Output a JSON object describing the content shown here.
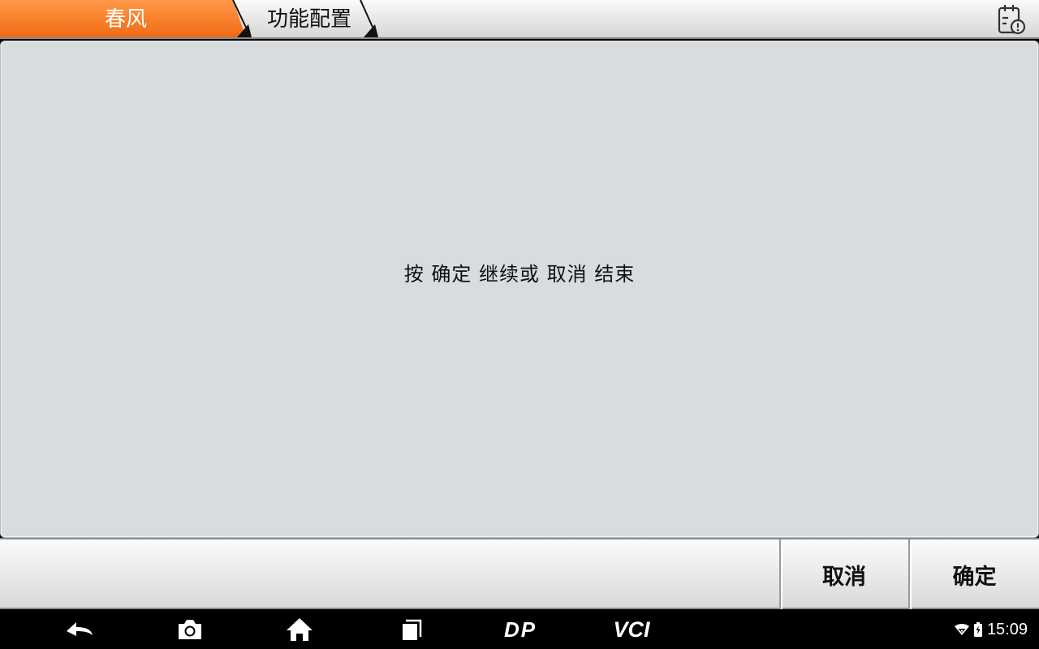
{
  "header": {
    "breadcrumbs": [
      {
        "label": "春风",
        "active": true
      },
      {
        "label": "功能配置",
        "active": false
      }
    ],
    "report_icon": "calendar-alert-icon",
    "colors": {
      "active": "#f47a20",
      "separator": "#111111"
    }
  },
  "content": {
    "message": "按 确定 继续或 取消 结束"
  },
  "actions": {
    "cancel_label": "取消",
    "ok_label": "确定"
  },
  "navbar": {
    "icons": [
      "back-icon",
      "camera-icon",
      "home-icon",
      "recent-apps-icon",
      "dp-logo-icon",
      "vci-icon"
    ],
    "dp_text": "DP",
    "vci_text": "VCI",
    "status_icons": [
      "wifi-icon",
      "battery-icon"
    ],
    "time": "15:09"
  }
}
